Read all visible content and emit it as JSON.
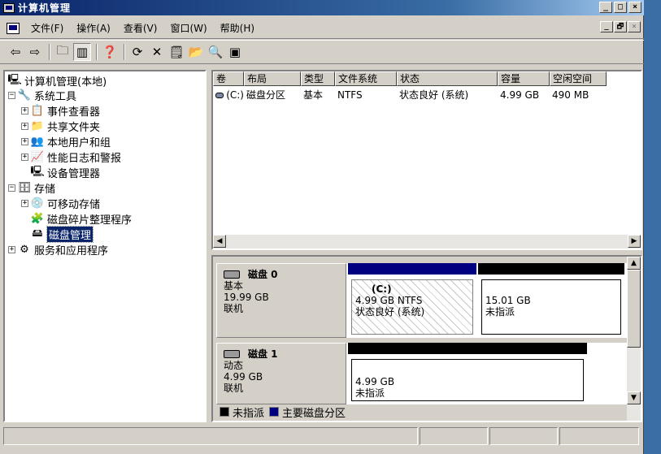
{
  "window": {
    "title": "计算机管理"
  },
  "caption_buttons": {
    "minimize": "_",
    "maximize": "□",
    "close": "×"
  },
  "menu": {
    "items": [
      "文件(F)",
      "操作(A)",
      "查看(V)",
      "窗口(W)",
      "帮助(H)"
    ],
    "mdi": {
      "minimize": "_",
      "restore": "🗗",
      "close": "×"
    }
  },
  "toolbar": {
    "buttons": [
      {
        "icon": "back-icon",
        "glyph": "⇦"
      },
      {
        "icon": "forward-icon",
        "glyph": "⇨"
      },
      {
        "icon": "up-level-icon",
        "glyph": "🗀"
      },
      {
        "icon": "show-tree-icon",
        "glyph": "▥"
      },
      {
        "icon": "help-icon",
        "glyph": "❓"
      },
      {
        "icon": "refresh-icon",
        "glyph": "⟳"
      },
      {
        "icon": "delete-icon",
        "glyph": "✕"
      },
      {
        "icon": "properties-icon",
        "glyph": "🗒"
      },
      {
        "icon": "open-icon",
        "glyph": "📂"
      },
      {
        "icon": "search-icon",
        "glyph": "🔍"
      },
      {
        "icon": "disk-icon",
        "glyph": "▣"
      }
    ]
  },
  "tree": {
    "items": [
      {
        "label": "计算机管理(本地)",
        "icon": "computer-icon",
        "glyph": "🖳",
        "expander": ""
      },
      {
        "label": "系统工具",
        "icon": "system-tools-icon",
        "glyph": "🔧",
        "expander": "−"
      },
      {
        "label": "事件查看器",
        "icon": "event-viewer-icon",
        "glyph": "📋",
        "expander": "+"
      },
      {
        "label": "共享文件夹",
        "icon": "shared-folder-icon",
        "glyph": "📁",
        "expander": "+"
      },
      {
        "label": "本地用户和组",
        "icon": "users-icon",
        "glyph": "👥",
        "expander": "+"
      },
      {
        "label": "性能日志和警报",
        "icon": "performance-icon",
        "glyph": "📈",
        "expander": "+"
      },
      {
        "label": "设备管理器",
        "icon": "device-manager-icon",
        "glyph": "🖳",
        "expander": ""
      },
      {
        "label": "存储",
        "icon": "storage-icon",
        "glyph": "🗄",
        "expander": "−"
      },
      {
        "label": "可移动存储",
        "icon": "removable-storage-icon",
        "glyph": "💿",
        "expander": "+"
      },
      {
        "label": "磁盘碎片整理程序",
        "icon": "defrag-icon",
        "glyph": "🧩",
        "expander": ""
      },
      {
        "label": "磁盘管理",
        "icon": "disk-management-icon",
        "glyph": "🖴",
        "expander": ""
      },
      {
        "label": "服务和应用程序",
        "icon": "services-icon",
        "glyph": "⚙",
        "expander": "+"
      }
    ],
    "selected_index": 10
  },
  "volume_list": {
    "columns": [
      "卷",
      "布局",
      "类型",
      "文件系统",
      "状态",
      "容量",
      "空闲空间"
    ],
    "rows": [
      {
        "volume": "(C:)",
        "layout": "磁盘分区",
        "type": "基本",
        "fs": "NTFS",
        "status": "状态良好 (系统)",
        "capacity": "4.99 GB",
        "free": "490 MB"
      }
    ]
  },
  "disks": [
    {
      "name": "磁盘 0",
      "type": "基本",
      "size": "19.99 GB",
      "state": "联机",
      "partitions": [
        {
          "label": "(C:)",
          "detail": "4.99 GB NTFS",
          "status": "状态良好 (系统)",
          "kind": "primary"
        },
        {
          "label": "",
          "detail": "15.01 GB",
          "status": "未指派",
          "kind": "unallocated"
        }
      ]
    },
    {
      "name": "磁盘 1",
      "type": "动态",
      "size": "4.99 GB",
      "state": "联机",
      "partitions": [
        {
          "label": "",
          "detail": "4.99 GB",
          "status": "未指派",
          "kind": "unallocated"
        }
      ]
    }
  ],
  "legend": [
    {
      "label": "未指派",
      "color": "#000000"
    },
    {
      "label": "主要磁盘分区",
      "color": "#000080"
    }
  ],
  "colors": {
    "titlebar": "#0a246a",
    "selection": "#0a246a",
    "primary_partition": "#000080",
    "unallocated": "#000000"
  }
}
